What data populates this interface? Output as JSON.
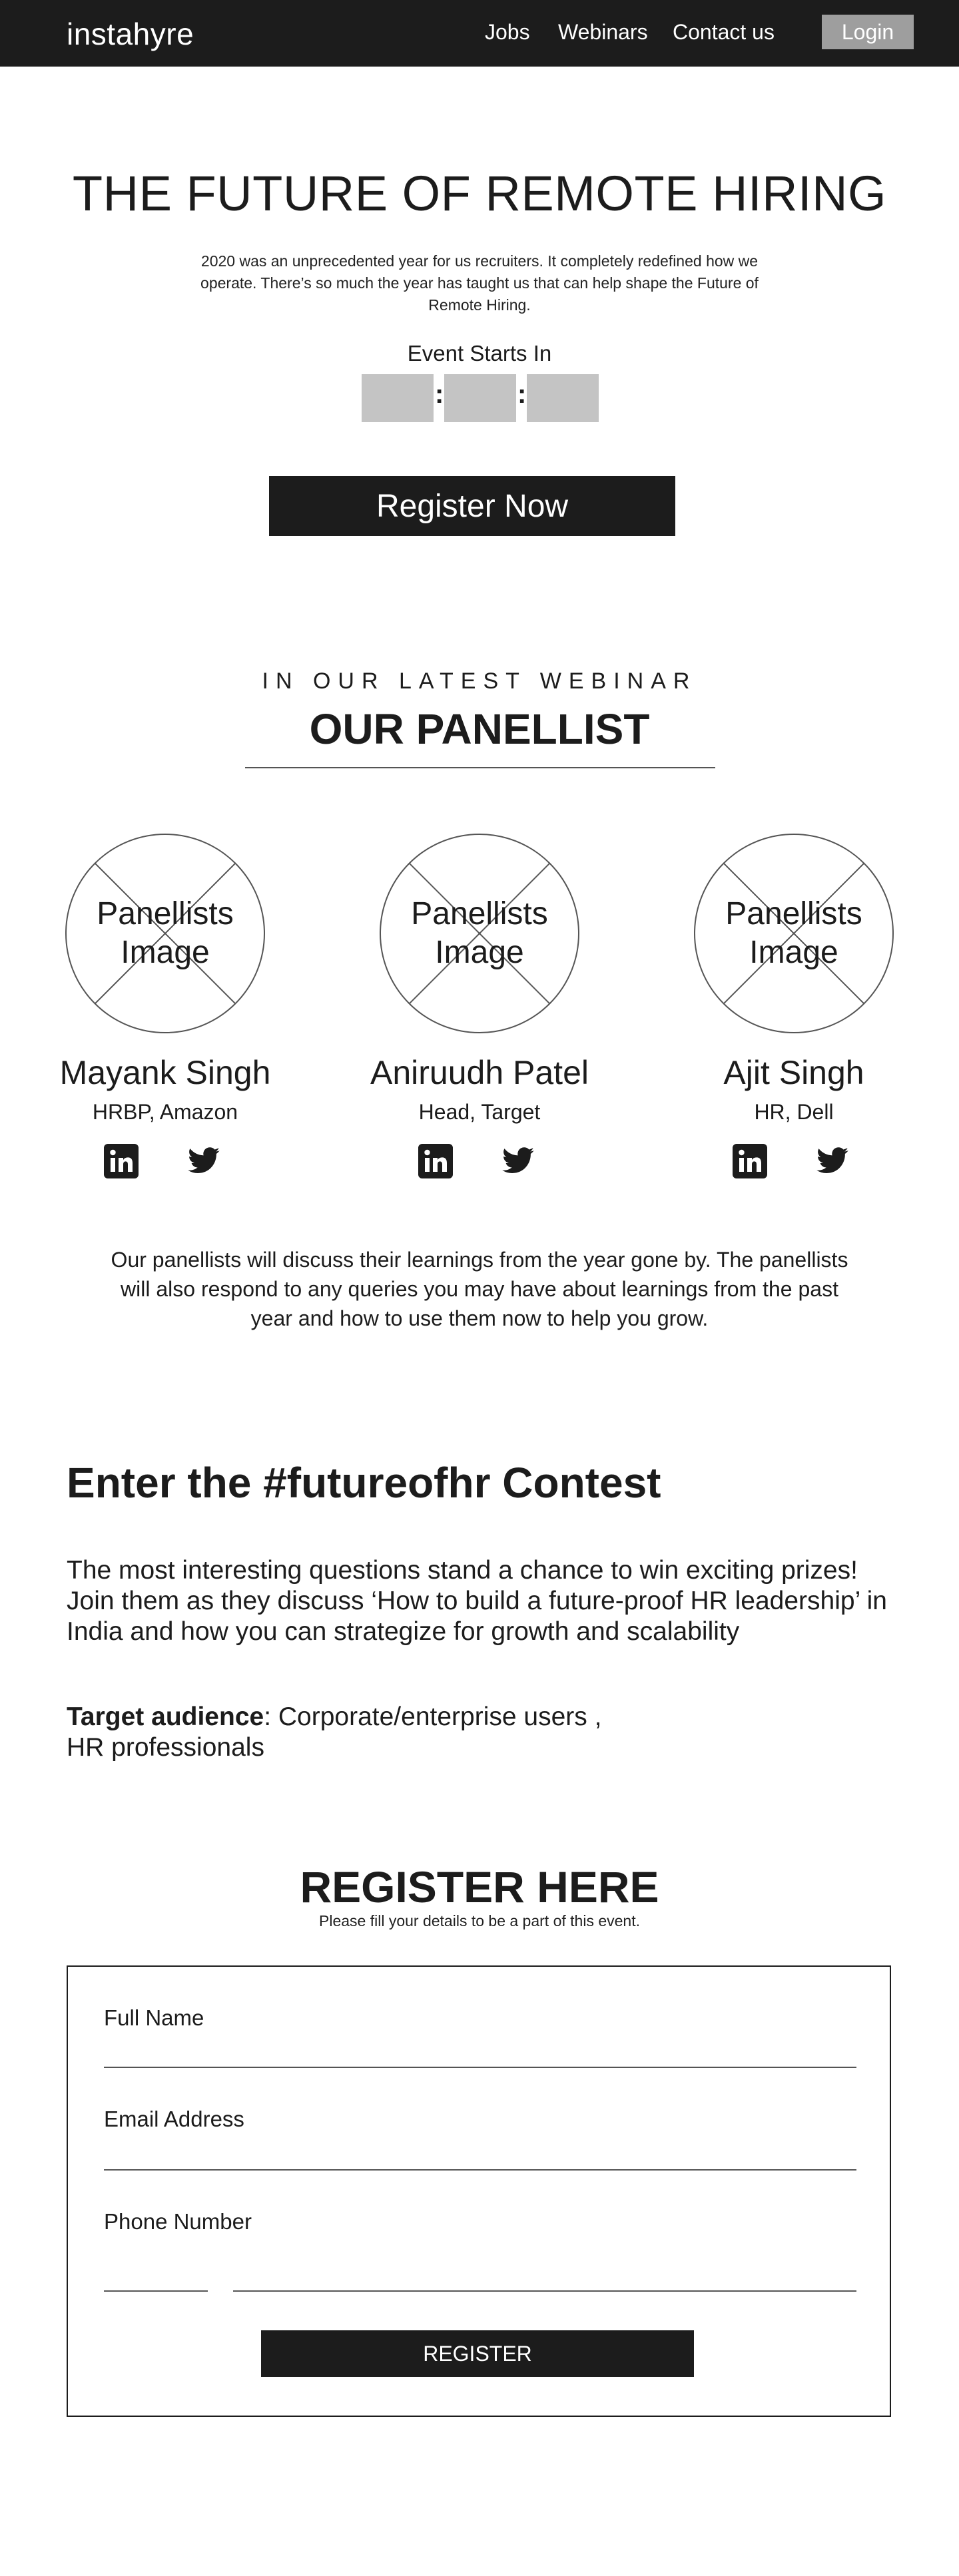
{
  "header": {
    "logo": "instahyre",
    "nav": [
      "Jobs",
      "Webinars",
      "Contact us"
    ],
    "login_label": "Login"
  },
  "hero": {
    "title": "THE FUTURE OF REMOTE HIRING",
    "description": "2020 was an unprecedented year for us recruiters. It completely redefined how we operate. There’s so much the year has taught us that can help shape the Future of Remote Hiring.",
    "event_label": "Event Starts In",
    "countdown_separator": ":",
    "register_label": "Register Now"
  },
  "panel": {
    "kicker": "IN OUR LATEST WEBINAR",
    "heading": "OUR PANELLIST",
    "placeholder_line1": "Panellists",
    "placeholder_line2": "Image",
    "panelists": [
      {
        "name": "Mayank Singh",
        "role": "HRBP, Amazon"
      },
      {
        "name": "Aniruudh Patel",
        "role": "Head, Target"
      },
      {
        "name": "Ajit Singh",
        "role": "HR, Dell"
      }
    ],
    "icons": [
      "linkedin-icon",
      "twitter-icon"
    ],
    "description": "Our panellists will discuss their learnings from the year gone by. The panellists will also respond to any queries you may have about learnings from the past year and how to use them now to help you grow."
  },
  "contest": {
    "heading_prefix": "Enter the ",
    "heading_tag": "#futureofhr",
    "heading_suffix": " Contest",
    "description": "The most interesting questions stand a chance to win exciting prizes! Join them as they discuss ‘How to build a future-proof HR leadership’ in India and how you can strategize for growth and scalability",
    "audience_label": "Target audience",
    "audience_value_line1": ": Corporate/enterprise users ,",
    "audience_value_line2": "HR professionals"
  },
  "register": {
    "heading": "REGISTER HERE",
    "subheading": "Please fill your details to be a part of this event.",
    "fields": [
      "Full Name",
      "Email Address",
      "Phone Number"
    ],
    "submit_label": "REGISTER"
  },
  "colors": {
    "dark": "#1c1c1c",
    "countdown_box": "#c4c4c4",
    "login_button": "#9e9e9e",
    "background": "#ffffff"
  }
}
